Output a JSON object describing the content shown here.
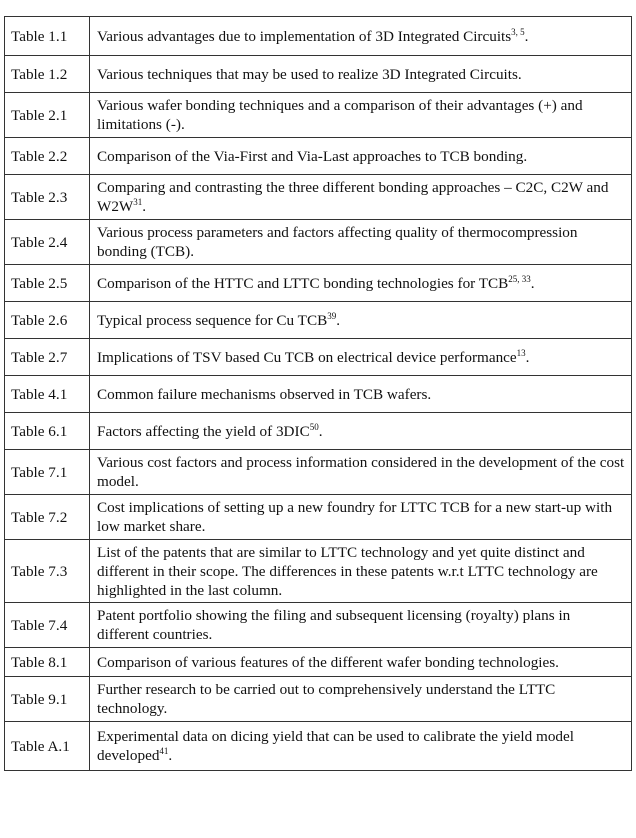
{
  "list_of_tables": [
    {
      "label": "Table 1.1",
      "text": "Various advantages due to implementation of 3D Integrated Circuits",
      "sup": "3, 5",
      "end": "."
    },
    {
      "label": "Table 1.2",
      "text": "Various techniques that may be used to realize 3D Integrated Circuits.",
      "sup": "",
      "end": ""
    },
    {
      "label": "Table 2.1",
      "text": "Various wafer bonding techniques and a comparison of their advantages (+) and limitations (-).",
      "sup": "",
      "end": ""
    },
    {
      "label": "Table 2.2",
      "text": "Comparison of the Via-First and Via-Last approaches to TCB bonding.",
      "sup": "",
      "end": ""
    },
    {
      "label": "Table 2.3",
      "text": "Comparing and contrasting the three different bonding approaches – C2C, C2W and W2W",
      "sup": "31",
      "end": "."
    },
    {
      "label": "Table 2.4",
      "text": "Various process parameters and factors affecting quality of thermocompression bonding (TCB).",
      "sup": "",
      "end": ""
    },
    {
      "label": "Table 2.5",
      "text": "Comparison of the HTTC and LTTC bonding technologies for TCB",
      "sup": "25, 33",
      "end": "."
    },
    {
      "label": "Table 2.6",
      "text": "Typical process sequence for Cu TCB",
      "sup": "39",
      "end": "."
    },
    {
      "label": "Table 2.7",
      "text": "Implications of TSV based Cu TCB on electrical device performance",
      "sup": "13",
      "end": "."
    },
    {
      "label": "Table 4.1",
      "text": "Common failure mechanisms observed in TCB wafers.",
      "sup": "",
      "end": ""
    },
    {
      "label": "Table 6.1",
      "text": "Factors affecting the yield of 3DIC",
      "sup": "50",
      "end": "."
    },
    {
      "label": "Table 7.1",
      "text": "Various cost factors and process information considered in the development of the cost model.",
      "sup": "",
      "end": ""
    },
    {
      "label": "Table 7.2",
      "text": "Cost implications of setting up a new foundry for LTTC TCB for a new start-up with low market share.",
      "sup": "",
      "end": ""
    },
    {
      "label": "Table 7.3",
      "text": "List of the patents that are similar to LTTC technology and yet quite distinct and different in their scope. The differences in these patents w.r.t LTTC technology are highlighted in the last column.",
      "sup": "",
      "end": ""
    },
    {
      "label": "Table 7.4",
      "text": "Patent portfolio showing the filing and subsequent licensing (royalty) plans in different countries.",
      "sup": "",
      "end": ""
    },
    {
      "label": "Table 8.1",
      "text": "Comparison of various features of the different wafer bonding technologies.",
      "sup": "",
      "end": ""
    },
    {
      "label": "Table 9.1",
      "text": "Further research to be carried out to comprehensively understand the LTTC technology.",
      "sup": "",
      "end": ""
    },
    {
      "label": "Table A.1",
      "text": "Experimental data on dicing yield that can be used to calibrate the yield model developed",
      "sup": "41",
      "end": "."
    }
  ]
}
